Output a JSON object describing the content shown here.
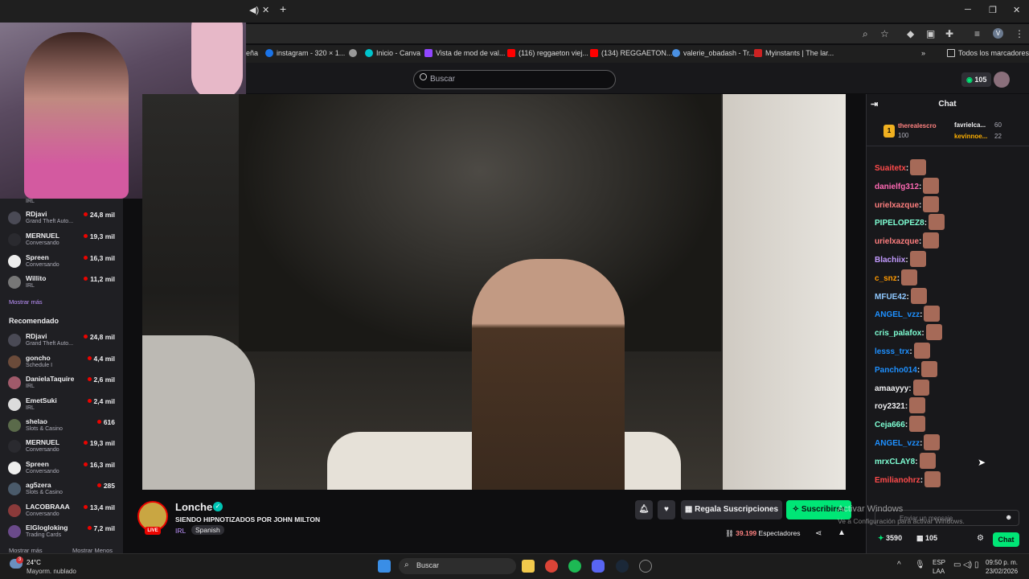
{
  "browser": {
    "new_tab": "+",
    "close_tab": "✕",
    "bookmarks": [
      {
        "label": "eña",
        "color": "#888888"
      },
      {
        "label": "instagram - 320 × 1...",
        "color": "#1a73e8"
      },
      {
        "label": "",
        "color": "#999999"
      },
      {
        "label": "Inicio - Canva",
        "color": "#00c4cc"
      },
      {
        "label": "Vista de mod de val...",
        "color": "#9146ff"
      },
      {
        "label": "(116) reggaeton viej...",
        "color": "#ff0000"
      },
      {
        "label": "(134) REGGAETON...",
        "color": "#ff0000"
      },
      {
        "label": "valerie_obadash - Tr...",
        "color": "#4a90e2"
      },
      {
        "label": "Myinstants | The lar...",
        "color": "#cc2222"
      }
    ],
    "all_bookmarks": "Todos los marcadores",
    "profile_initial": "V"
  },
  "twitch": {
    "search_placeholder": "Buscar",
    "points": "105"
  },
  "sidebar": {
    "top_partial_game": "IRL",
    "followed": [
      {
        "name": "RDjavi",
        "game": "Grand Theft Auto...",
        "viewers": "24,8 mil"
      },
      {
        "name": "MERNUEL",
        "game": "Conversando",
        "viewers": "19,3 mil"
      },
      {
        "name": "Spreen",
        "game": "Conversando",
        "viewers": "16,3 mil"
      },
      {
        "name": "Willito",
        "game": "IRL",
        "viewers": "11,2 mil"
      }
    ],
    "show_more": "Mostrar más",
    "recommended_title": "Recomendado",
    "recommended": [
      {
        "name": "RDjavi",
        "game": "Grand Theft Auto...",
        "viewers": "24,8 mil"
      },
      {
        "name": "goncho",
        "game": "Schedule I",
        "viewers": "4,4 mil"
      },
      {
        "name": "DanielaTaquire",
        "game": "IRL",
        "viewers": "2,6 mil"
      },
      {
        "name": "EmetSuki",
        "game": "IRL",
        "viewers": "2,4 mil"
      },
      {
        "name": "shelao",
        "game": "Slots & Casino",
        "viewers": "616"
      },
      {
        "name": "MERNUEL",
        "game": "Conversando",
        "viewers": "19,3 mil"
      },
      {
        "name": "Spreen",
        "game": "Conversando",
        "viewers": "16,3 mil"
      },
      {
        "name": "ag5zera",
        "game": "Slots & Casino",
        "viewers": "285"
      },
      {
        "name": "LACOBRAAA",
        "game": "Conversando",
        "viewers": "13,4 mil"
      },
      {
        "name": "ElGlogloking",
        "game": "Trading Cards",
        "viewers": "7,2 mil"
      }
    ],
    "show_more_2": "Mostrar más",
    "show_less": "Mostrar Menos"
  },
  "stream": {
    "live": "LIVE",
    "streamer": "Lonche",
    "title": "SIENDO HIPNOTIZADOS POR JOHN MILTON",
    "category": "IRL",
    "language": "Spanish",
    "gift_label": "Regala Suscripciones",
    "subscribe_label": "Suscribirse",
    "viewers_count": "39.199",
    "viewers_label": "Espectadores"
  },
  "chat": {
    "title": "Chat",
    "leaderboard": [
      {
        "rank": "1",
        "name": "therealescro",
        "value": "100"
      },
      {
        "rank": "",
        "name": "favrielca...",
        "value": "60"
      },
      {
        "rank": "",
        "name": "kevinnoe...",
        "value": "22"
      }
    ],
    "messages": [
      {
        "user": "Suaitetx",
        "color": "#ff4b4b"
      },
      {
        "user": "danielfg312",
        "color": "#ff69b4"
      },
      {
        "user": "urielxazque",
        "color": "#ff7f7f"
      },
      {
        "user": "PIPELOPEZ8",
        "color": "#7fffd4"
      },
      {
        "user": "urielxazque",
        "color": "#ff7f7f"
      },
      {
        "user": "Blachiix",
        "color": "#c39bff"
      },
      {
        "user": "c_snz",
        "color": "#ff9900"
      },
      {
        "user": "MFUE42",
        "color": "#8fc8ff"
      },
      {
        "user": "ANGEL_vzz",
        "color": "#1e90ff"
      },
      {
        "user": "cris_palafox",
        "color": "#7fffd4"
      },
      {
        "user": "lesss_trx",
        "color": "#1e90ff"
      },
      {
        "user": "Pancho014",
        "color": "#1e90ff"
      },
      {
        "user": "amaayyy",
        "color": "#efeff1"
      },
      {
        "user": "roy2321",
        "color": "#efeff1"
      },
      {
        "user": "Ceja666",
        "color": "#7fffd4"
      },
      {
        "user": "ANGEL_vzz",
        "color": "#1e90ff"
      },
      {
        "user": "mrxCLAY8",
        "color": "#7fffd4"
      },
      {
        "user": "Emilianohrz",
        "color": "#ff4b4b"
      }
    ],
    "input_placeholder": "Enviar un mensaje",
    "points": "3590",
    "bits": "105",
    "send_label": "Chat"
  },
  "watermark": {
    "line1": "Activar Windows",
    "line2": "Ve a Configuración para activar Windows."
  },
  "taskbar": {
    "weather_badge": "3",
    "temp": "24°C",
    "weather_desc": "Mayorm. nublado",
    "search": "Buscar",
    "lang1": "ESP",
    "lang2": "LAA",
    "time": "09:50 p. m.",
    "date": "23/02/2026"
  }
}
